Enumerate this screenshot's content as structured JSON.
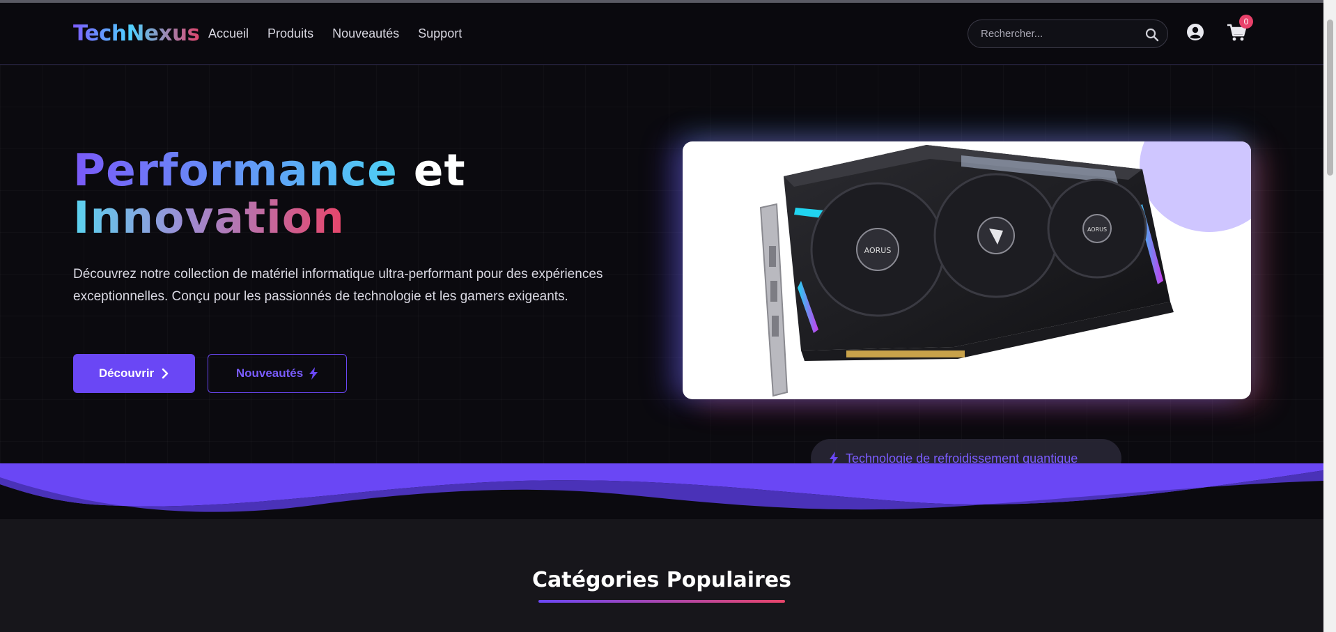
{
  "brand": {
    "logo_text": "TechNexus"
  },
  "nav": {
    "links": [
      "Accueil",
      "Produits",
      "Nouveautés",
      "Support"
    ]
  },
  "search": {
    "placeholder": "Rechercher...",
    "icon": "search-icon"
  },
  "account": {
    "icon": "user-circle-icon"
  },
  "cart": {
    "icon": "shopping-cart-icon",
    "count": "0"
  },
  "hero": {
    "title_part1": "Performance",
    "title_part2": " et",
    "title_part3": "Innovation",
    "description": "Découvrez notre collection de matériel informatique ultra-performant pour des expériences exceptionnelles. Conçu pour les passionnés de technologie et les gamers exigeants.",
    "primary_button": "Découvrir",
    "secondary_button": "Nouveautés",
    "feature_pill": "Technologie de refroidissement quantique",
    "image": "graphics-card-product-image"
  },
  "categories": {
    "title": "Catégories Populaires"
  },
  "colors": {
    "accent": "#6a47f5",
    "cyan": "#4ed0f5",
    "pink": "#e8456a",
    "background": "#0b0a0f"
  }
}
